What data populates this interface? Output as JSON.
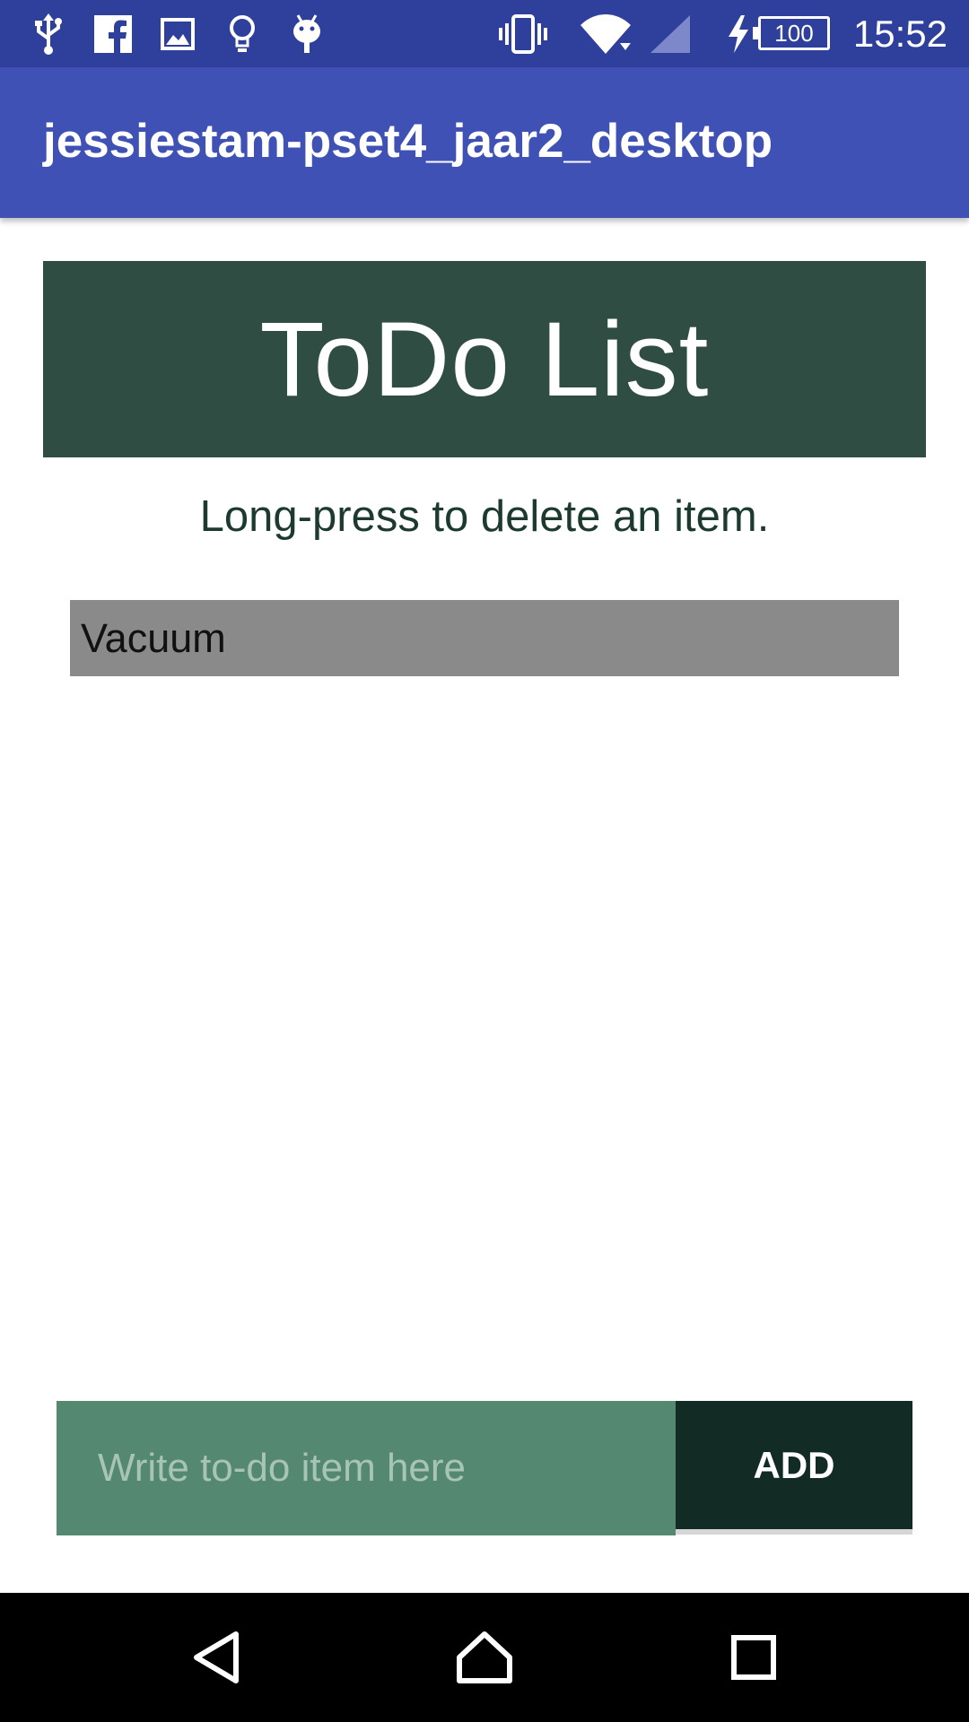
{
  "status_bar": {
    "time": "15:52",
    "battery_level": "100",
    "left_icons": [
      "usb-icon",
      "facebook-icon",
      "image-icon",
      "lightbulb-icon",
      "android-icon"
    ],
    "right_icons": [
      "vibrate-icon",
      "wifi-icon",
      "signal-icon",
      "charging-icon",
      "battery-icon"
    ],
    "color": "#2f3f9c"
  },
  "app_bar": {
    "title": "jessiestam-pset4_jaar2_desktop",
    "color": "#3f51b5"
  },
  "header": {
    "title": "ToDo List",
    "color": "#304d44"
  },
  "hint": {
    "text": "Long-press to delete an item."
  },
  "todo_list": {
    "items": [
      {
        "label": "Vacuum"
      }
    ],
    "item_color": "#8a8a8a"
  },
  "input": {
    "placeholder": "Write to-do item here",
    "value": "",
    "color": "#558870"
  },
  "add_button": {
    "label": "ADD",
    "color": "#122b24"
  },
  "nav_bar": {
    "icons": [
      "back-icon",
      "home-icon",
      "recents-icon"
    ]
  }
}
